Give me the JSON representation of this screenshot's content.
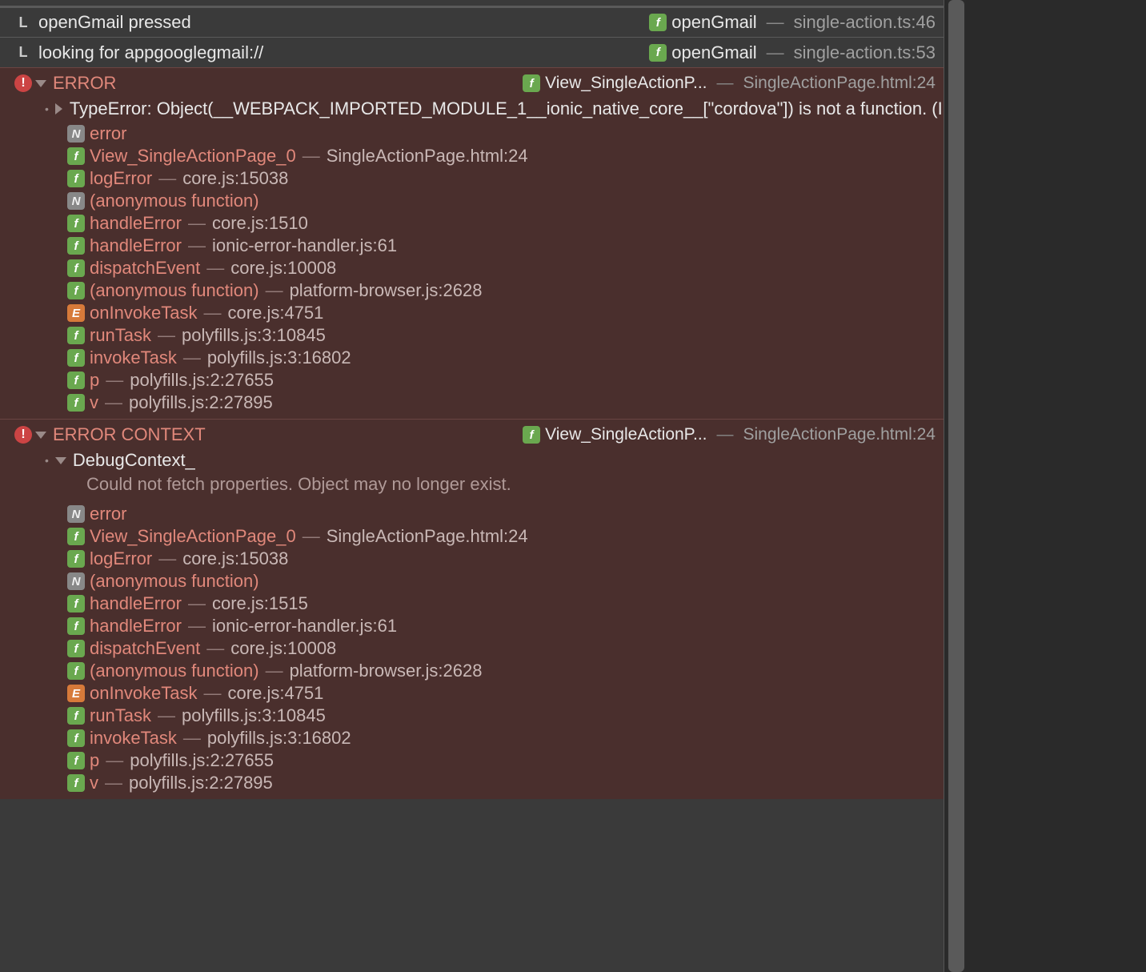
{
  "logs": [
    {
      "icon": "L",
      "text": "openGmail pressed",
      "src_fn": "openGmail",
      "src_file": "single-action.ts:46"
    },
    {
      "icon": "L",
      "text": "looking for appgooglegmail://",
      "src_fn": "openGmail",
      "src_file": "single-action.ts:53"
    }
  ],
  "errors": [
    {
      "title": "ERROR",
      "src_fn": "View_SingleActionP...",
      "src_file": "SingleActionPage.html:24",
      "message_toggle": "right",
      "message": "TypeError: Object(__WEBPACK_IMPORTED_MODULE_1__ionic_native_core__[\"cordova\"]) is not a function. (In 'Ob",
      "note": null,
      "stack": [
        {
          "badge": "N",
          "fn": "error",
          "file": null
        },
        {
          "badge": "F",
          "fn": "View_SingleActionPage_0",
          "file": "SingleActionPage.html:24"
        },
        {
          "badge": "F",
          "fn": "logError",
          "file": "core.js:15038"
        },
        {
          "badge": "N",
          "fn": "(anonymous function)",
          "file": null
        },
        {
          "badge": "F",
          "fn": "handleError",
          "file": "core.js:1510"
        },
        {
          "badge": "F",
          "fn": "handleError",
          "file": "ionic-error-handler.js:61"
        },
        {
          "badge": "F",
          "fn": "dispatchEvent",
          "file": "core.js:10008"
        },
        {
          "badge": "F",
          "fn": "(anonymous function)",
          "file": "platform-browser.js:2628"
        },
        {
          "badge": "E",
          "fn": "onInvokeTask",
          "file": "core.js:4751"
        },
        {
          "badge": "F",
          "fn": "runTask",
          "file": "polyfills.js:3:10845"
        },
        {
          "badge": "F",
          "fn": "invokeTask",
          "file": "polyfills.js:3:16802"
        },
        {
          "badge": "F",
          "fn": "p",
          "file": "polyfills.js:2:27655"
        },
        {
          "badge": "F",
          "fn": "v",
          "file": "polyfills.js:2:27895"
        }
      ]
    },
    {
      "title": "ERROR CONTEXT",
      "src_fn": "View_SingleActionP...",
      "src_file": "SingleActionPage.html:24",
      "message_toggle": "down",
      "message": "DebugContext_",
      "note": "Could not fetch properties. Object may no longer exist.",
      "stack": [
        {
          "badge": "N",
          "fn": "error",
          "file": null
        },
        {
          "badge": "F",
          "fn": "View_SingleActionPage_0",
          "file": "SingleActionPage.html:24"
        },
        {
          "badge": "F",
          "fn": "logError",
          "file": "core.js:15038"
        },
        {
          "badge": "N",
          "fn": "(anonymous function)",
          "file": null
        },
        {
          "badge": "F",
          "fn": "handleError",
          "file": "core.js:1515"
        },
        {
          "badge": "F",
          "fn": "handleError",
          "file": "ionic-error-handler.js:61"
        },
        {
          "badge": "F",
          "fn": "dispatchEvent",
          "file": "core.js:10008"
        },
        {
          "badge": "F",
          "fn": "(anonymous function)",
          "file": "platform-browser.js:2628"
        },
        {
          "badge": "E",
          "fn": "onInvokeTask",
          "file": "core.js:4751"
        },
        {
          "badge": "F",
          "fn": "runTask",
          "file": "polyfills.js:3:10845"
        },
        {
          "badge": "F",
          "fn": "invokeTask",
          "file": "polyfills.js:3:16802"
        },
        {
          "badge": "F",
          "fn": "p",
          "file": "polyfills.js:2:27655"
        },
        {
          "badge": "F",
          "fn": "v",
          "file": "polyfills.js:2:27895"
        }
      ]
    }
  ],
  "labels": {
    "dash": "—"
  }
}
